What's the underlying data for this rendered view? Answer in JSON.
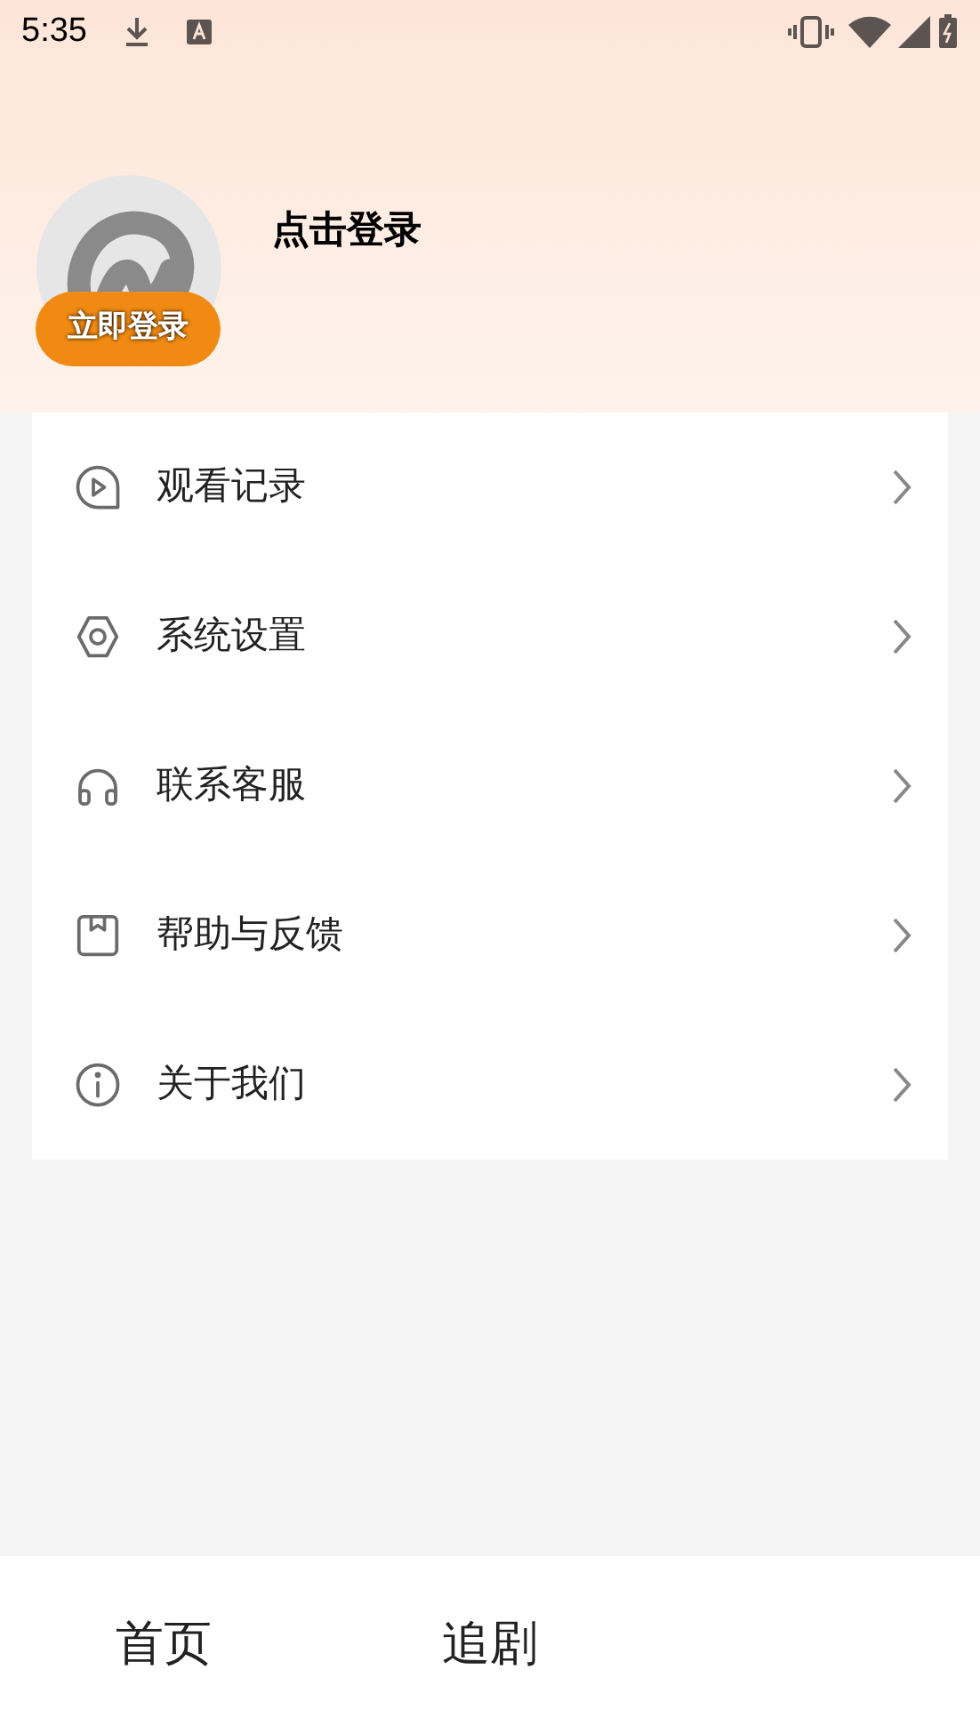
{
  "status_bar": {
    "time": "5:35"
  },
  "profile": {
    "title": "点击登录",
    "login_button": "立即登录"
  },
  "menu": [
    {
      "kind": "history",
      "label": "观看记录"
    },
    {
      "kind": "settings",
      "label": "系统设置"
    },
    {
      "kind": "support",
      "label": "联系客服"
    },
    {
      "kind": "feedback",
      "label": "帮助与反馈"
    },
    {
      "kind": "about",
      "label": "关于我们"
    }
  ],
  "bottom_nav": [
    {
      "label": "首页"
    },
    {
      "label": "追剧"
    }
  ]
}
